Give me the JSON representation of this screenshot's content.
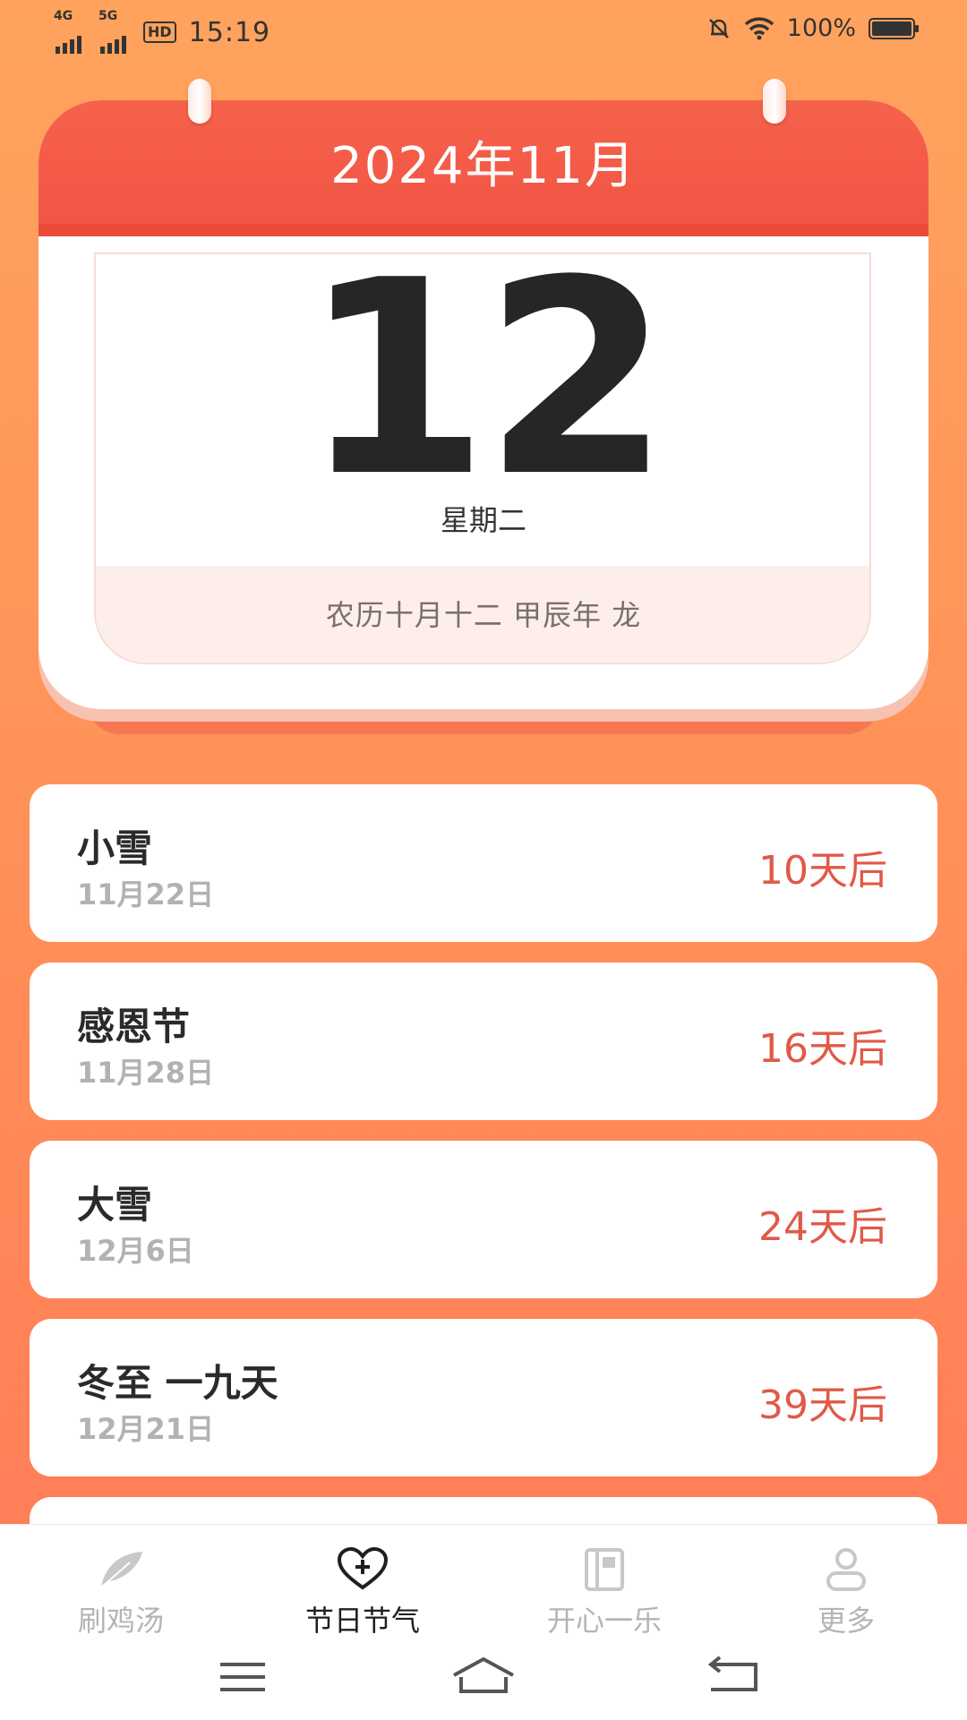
{
  "status_bar": {
    "sig1": "4G",
    "sig2": "5G",
    "hd": "HD",
    "time": "15:19",
    "battery": "100%"
  },
  "calendar": {
    "year_month": "2024年11月",
    "day": "12",
    "weekday": "星期二",
    "lunar": "农历十月十二 甲辰年 龙"
  },
  "events": [
    {
      "name": "小雪",
      "date": "11月22日",
      "countdown": "10天后"
    },
    {
      "name": "感恩节",
      "date": "11月28日",
      "countdown": "16天后"
    },
    {
      "name": "大雪",
      "date": "12月6日",
      "countdown": "24天后"
    },
    {
      "name": "冬至 一九天",
      "date": "12月21日",
      "countdown": "39天后"
    }
  ],
  "tabs": [
    {
      "label": "刷鸡汤",
      "icon": "feather-icon"
    },
    {
      "label": "节日节气",
      "icon": "heart-plus-icon"
    },
    {
      "label": "开心一乐",
      "icon": "book-icon"
    },
    {
      "label": "更多",
      "icon": "user-icon"
    }
  ],
  "colors": {
    "accent_red": "#f25546",
    "countdown": "#e05a47",
    "background_top": "#ffa35d",
    "background_bottom": "#ff7a57"
  }
}
